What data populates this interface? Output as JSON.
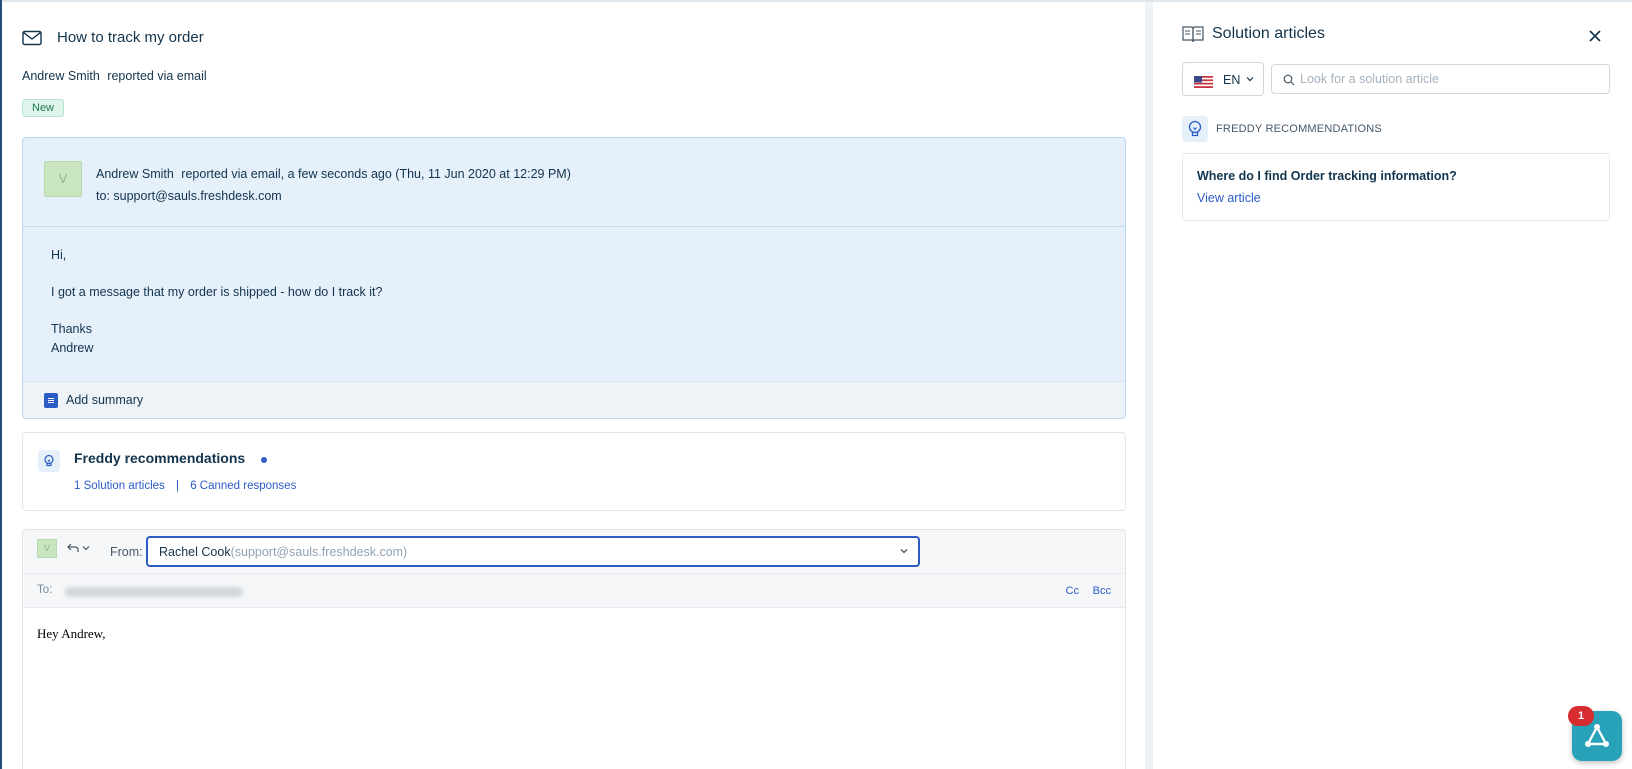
{
  "ticket": {
    "title": "How to track my order",
    "reporter_name": "Andrew Smith",
    "reporter_suffix": "reported via email",
    "status": "New"
  },
  "conversation": {
    "avatar_letter": "V",
    "sender_name": "Andrew Smith",
    "meta_text": "reported via email, a few seconds ago (Thu, 11 Jun 2020 at 12:29 PM)",
    "to_label": "to:",
    "to_address": "support@sauls.freshdesk.com",
    "body": {
      "greeting": "Hi,",
      "message": "I got a message that my order is shipped - how do I track it?",
      "closing": "Thanks",
      "signature": "Andrew"
    },
    "summary_label": "Add summary"
  },
  "freddy": {
    "title": "Freddy recommendations",
    "solution_link": "1 Solution articles",
    "separator": "|",
    "canned_link": "6 Canned responses"
  },
  "reply": {
    "avatar_letter": "V",
    "from_label": "From:",
    "from_name": "Rachel Cook",
    "from_email": "(support@sauls.freshdesk.com)",
    "to_label": "To:",
    "cc_label": "Cc",
    "bcc_label": "Bcc",
    "body": "Hey Andrew,"
  },
  "panel": {
    "title": "Solution articles",
    "language": "EN",
    "search_placeholder": "Look for a solution article",
    "recommendations_label": "FREDDY RECOMMENDATIONS",
    "article": {
      "title": "Where do I find Order tracking information?",
      "link": "View article"
    }
  },
  "fab": {
    "badge_count": "1"
  },
  "colors": {
    "accent": "#2c5cc5",
    "conversation_bg": "#e5f0fb",
    "status_new": "#1c7a4b",
    "fab_bg": "#27a2b9",
    "badge_bg": "#d72d30"
  }
}
